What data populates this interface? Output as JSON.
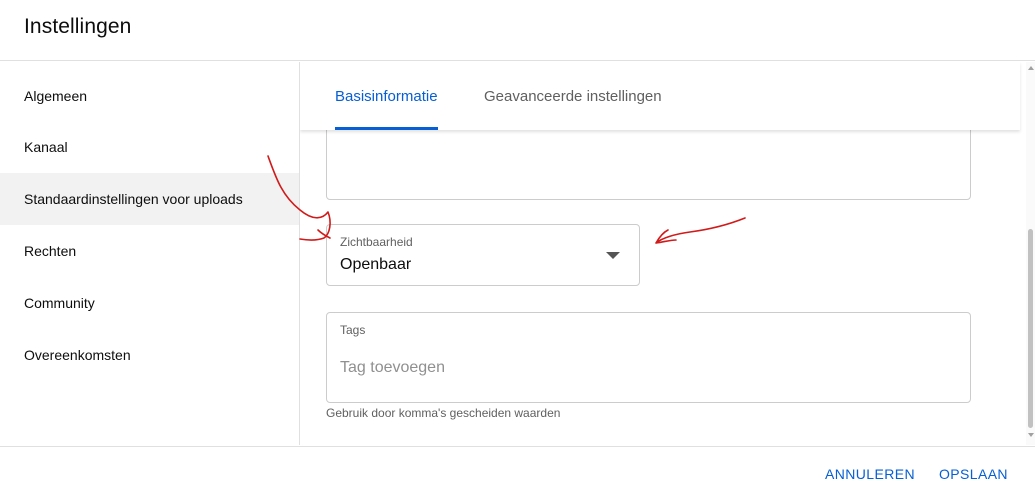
{
  "header": {
    "title": "Instellingen"
  },
  "sidebar": {
    "items": [
      {
        "label": "Algemeen"
      },
      {
        "label": "Kanaal"
      },
      {
        "label": "Standaardinstellingen voor uploads"
      },
      {
        "label": "Rechten"
      },
      {
        "label": "Community"
      },
      {
        "label": "Overeenkomsten"
      }
    ]
  },
  "tabs": [
    {
      "label": "Basisinformatie"
    },
    {
      "label": "Geavanceerde instellingen"
    }
  ],
  "visibility": {
    "label": "Zichtbaarheid",
    "value": "Openbaar"
  },
  "tags": {
    "label": "Tags",
    "placeholder": "Tag toevoegen",
    "helper": "Gebruik door komma's gescheiden waarden"
  },
  "footer": {
    "cancel": "ANNULEREN",
    "save": "OPSLAAN"
  },
  "colors": {
    "accent": "#065fd4",
    "annotation": "#d11a1a",
    "active_sidebar_bg": "#f2f2f2"
  }
}
